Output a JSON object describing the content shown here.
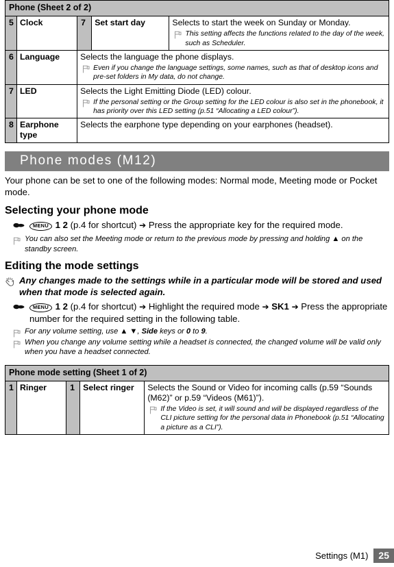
{
  "table_phone": {
    "caption": "Phone (Sheet 2 of 2)",
    "rows": [
      {
        "num": "5",
        "name": "Clock",
        "subnum": "7",
        "sublabel": "Set start day",
        "desc": "Selects to start the week on Sunday or Monday.",
        "notes": [
          "This setting affects the functions related to the day of the week, such as Scheduler."
        ]
      },
      {
        "num": "6",
        "name": "Language",
        "subnum": "",
        "sublabel": "",
        "desc": "Selects the language the phone displays.",
        "notes": [
          "Even if you change the language settings, some names, such as that of desktop icons and pre-set folders in My data, do not change."
        ]
      },
      {
        "num": "7",
        "name": "LED",
        "subnum": "",
        "sublabel": "",
        "desc": "Selects the Light Emitting Diode (LED) colour.",
        "notes": [
          "If the personal setting or the Group setting for the LED colour is also set in the phonebook, it has priority over this LED setting (p.51 “Allocating a LED colour”)."
        ]
      },
      {
        "num": "8",
        "name": "Earphone type",
        "subnum": "",
        "sublabel": "",
        "desc": "Selects the earphone type depending on your earphones (headset).",
        "notes": []
      }
    ]
  },
  "section": {
    "title": "Phone modes (M12)",
    "intro": "Your phone can be set to one of the following modes: Normal mode, Meeting mode or Pocket mode."
  },
  "selecting": {
    "heading": "Selecting your phone mode",
    "menu_key": "MENU",
    "step_code": "1 2",
    "step_shortcut": "(p.4 for shortcut)",
    "arrow": "➔",
    "step_action": "Press the appropriate key for the required mode.",
    "note": "You can also set the Meeting mode or return to the previous mode by pressing and holding ▲ on the standby screen."
  },
  "editing": {
    "heading": "Editing the mode settings",
    "warning": "Any changes made to the settings while in a particular mode will be stored and used when that mode is selected again.",
    "menu_key": "MENU",
    "step_code": "1 2",
    "step_shortcut": "(p.4 for shortcut)",
    "arrow": "➔",
    "step_part1": "Highlight the required mode",
    "softkey": "SK1",
    "step_part2": "Press the appropriate number for the required setting in the following table.",
    "note1_pre": "For any volume setting, use ▲ ▼, ",
    "note1_side": "Side",
    "note1_mid": " keys or ",
    "note1_zero": "0",
    "note1_to": " to ",
    "note1_nine": "9",
    "note1_end": ".",
    "note2": "When you change any volume setting while a headset is connected, the changed volume will be valid only when you have a headset connected."
  },
  "table_modesetting": {
    "caption": "Phone mode setting (Sheet 1 of 2)",
    "rows": [
      {
        "num": "1",
        "name": "Ringer",
        "subnum": "1",
        "sublabel": "Select ringer",
        "desc": "Selects the Sound or Video for incoming calls (p.59 “Sounds (M62)” or p.59 “Videos (M61)”).",
        "notes": [
          "If the Video is set, it will sound and will be displayed regardless of the CLI picture setting for the personal data in Phonebook (p.51 “Allocating a picture as a CLI”)."
        ]
      }
    ]
  },
  "footer": {
    "label": "Settings (M1)",
    "page": "25"
  },
  "icons": {
    "note": "flag-note-icon",
    "warning": "stop-hand-icon",
    "pointer": "pointing-hand-icon"
  },
  "colors": {
    "band": "#808080",
    "header_cell": "#bfbfbf",
    "page_badge": "#6b6b6b"
  }
}
